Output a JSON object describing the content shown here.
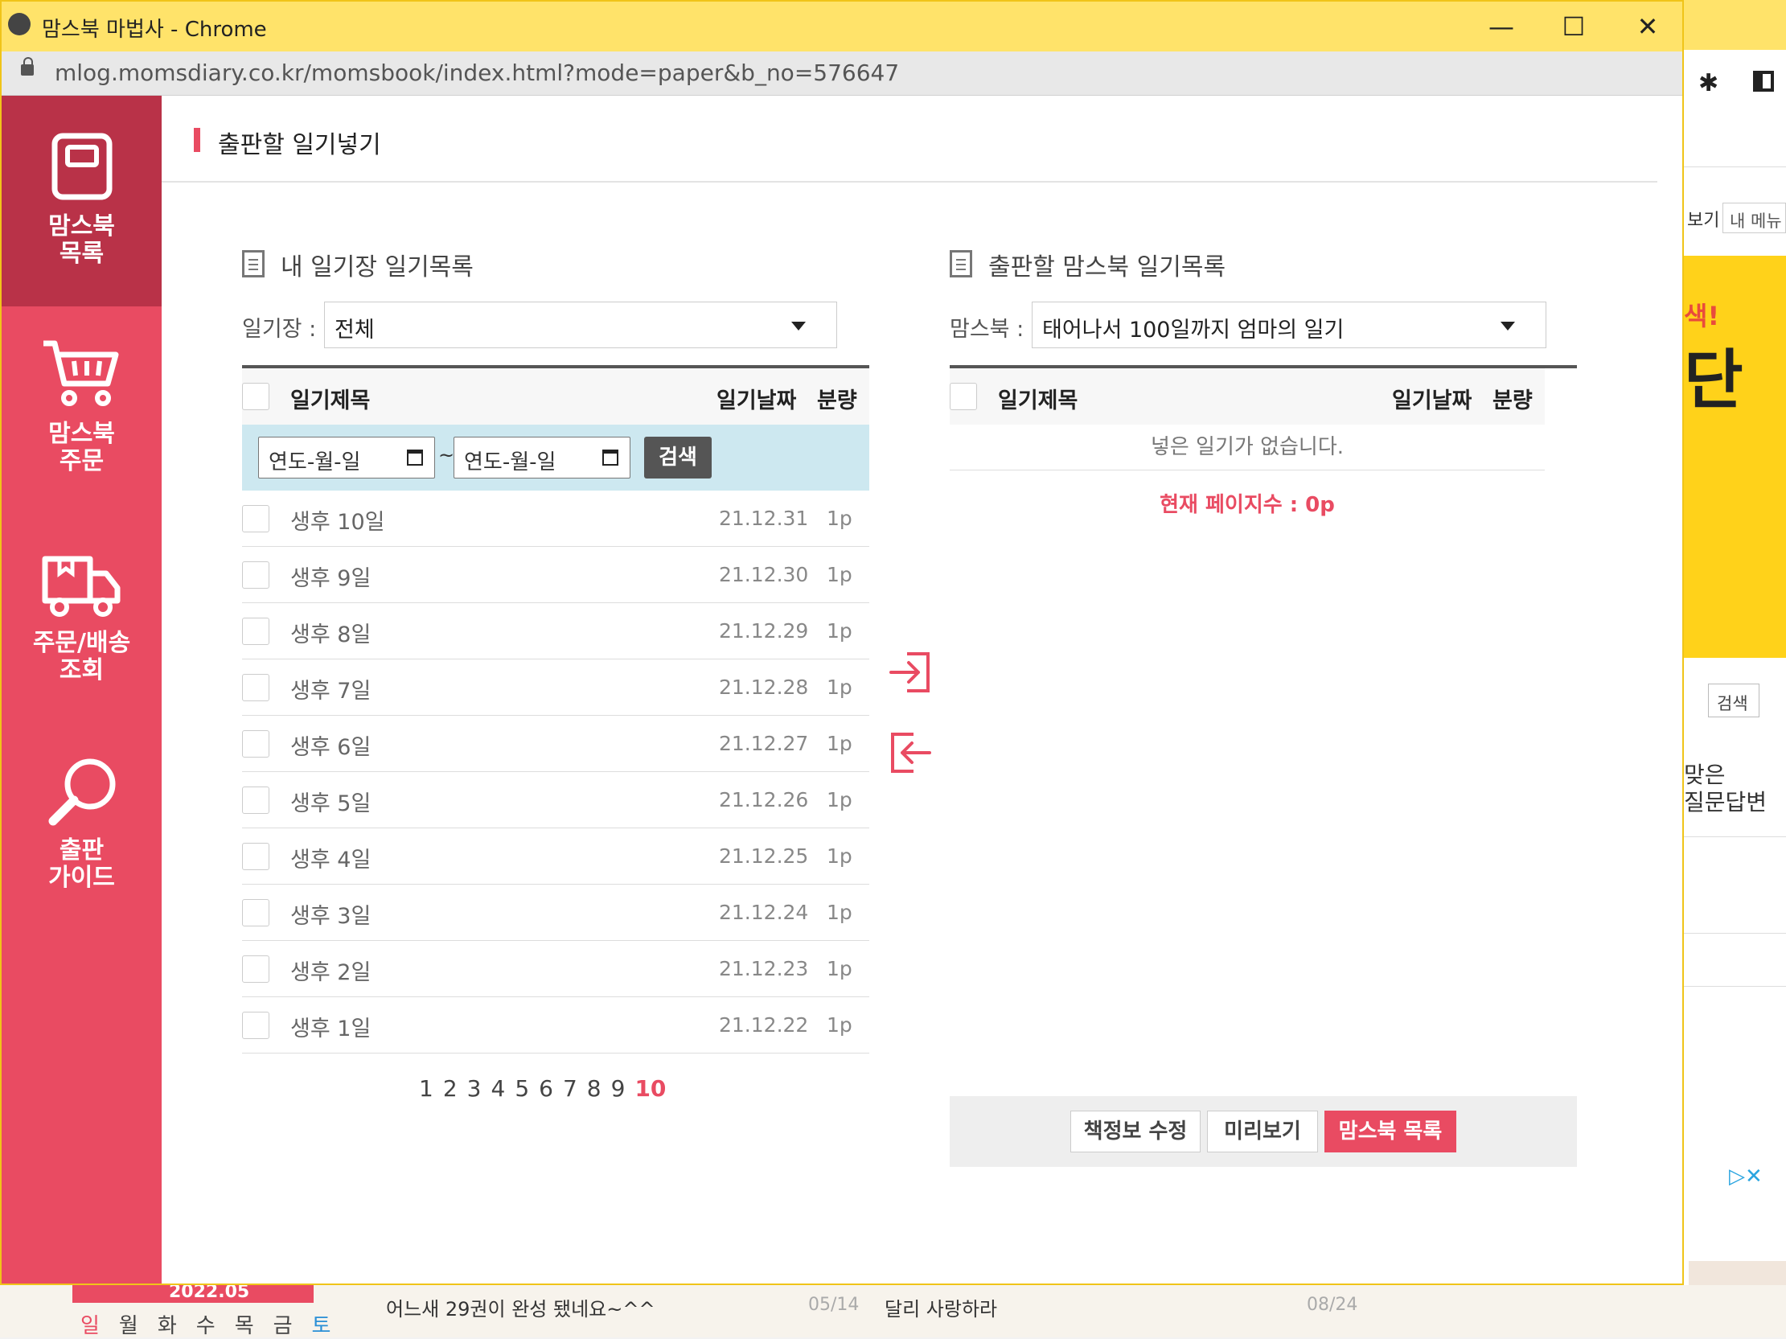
{
  "window": {
    "title": "맘스북 마법사 - Chrome",
    "url": "mlog.momsdiary.co.kr/momsbook/index.html?mode=paper&b_no=576647",
    "minimize_glyph": "—",
    "maximize_glyph": "☐",
    "close_glyph": "✕"
  },
  "sidebar": {
    "items": [
      {
        "label_1": "맘스북",
        "label_2": "목록",
        "icon": "book-icon",
        "active": true
      },
      {
        "label_1": "맘스북",
        "label_2": "주문",
        "icon": "cart-icon",
        "active": false
      },
      {
        "label_1": "주문/배송",
        "label_2": "조회",
        "icon": "truck-icon",
        "active": false
      },
      {
        "label_1": "출판",
        "label_2": "가이드",
        "icon": "magnifier-icon",
        "active": false
      }
    ]
  },
  "page": {
    "title": "출판할 일기넣기"
  },
  "left_panel": {
    "title": "내 일기장 일기목록",
    "select_label": "일기장 :",
    "select_value": "전체",
    "columns": {
      "title": "일기제목",
      "date": "일기날짜",
      "pages": "분량"
    },
    "date_from_placeholder": "연도-월-일",
    "date_to_placeholder": "연도-월-일",
    "date_separator": "~",
    "search_label": "검색",
    "rows": [
      {
        "title": "생후 10일",
        "date": "21.12.31",
        "pages": "1p"
      },
      {
        "title": "생후 9일",
        "date": "21.12.30",
        "pages": "1p"
      },
      {
        "title": "생후 8일",
        "date": "21.12.29",
        "pages": "1p"
      },
      {
        "title": "생후 7일",
        "date": "21.12.28",
        "pages": "1p"
      },
      {
        "title": "생후 6일",
        "date": "21.12.27",
        "pages": "1p"
      },
      {
        "title": "생후 5일",
        "date": "21.12.26",
        "pages": "1p"
      },
      {
        "title": "생후 4일",
        "date": "21.12.25",
        "pages": "1p"
      },
      {
        "title": "생후 3일",
        "date": "21.12.24",
        "pages": "1p"
      },
      {
        "title": "생후 2일",
        "date": "21.12.23",
        "pages": "1p"
      },
      {
        "title": "생후 1일",
        "date": "21.12.22",
        "pages": "1p"
      }
    ],
    "pagination": [
      "1",
      "2",
      "3",
      "4",
      "5",
      "6",
      "7",
      "8",
      "9",
      "10"
    ],
    "current_page": "10"
  },
  "right_panel": {
    "title": "출판할 맘스북 일기목록",
    "select_label": "맘스북 :",
    "select_value": "태어나서 100일까지 엄마의 일기",
    "columns": {
      "title": "일기제목",
      "date": "일기날짜",
      "pages": "분량"
    },
    "empty_message": "넣은 일기가 없습니다.",
    "page_count": "현재 페이지수 : 0p",
    "buttons": {
      "edit_info": "책정보 수정",
      "preview": "미리보기",
      "list": "맘스북 목록"
    }
  },
  "background_page": {
    "tab_label_1": "보기",
    "tab_label_2": "내 메뉴",
    "ad_text_1": "색!",
    "ad_text_2": "단",
    "search_label": "검색",
    "qa_line_1": "맞은",
    "qa_line_2": "질문답변",
    "calendar_title": "2022.05",
    "weekdays": [
      "일",
      "월",
      "화",
      "수",
      "목",
      "금",
      "토"
    ],
    "posts": [
      {
        "title": "어느새 29권이 완성 됐네요~^^",
        "date": "05/14"
      },
      {
        "title": "달리 사랑하라",
        "date": "08/24"
      }
    ]
  },
  "colors": {
    "accent": "#e94b62",
    "sidebar_active": "#b93248",
    "filter_bar": "#cde8f0",
    "chrome_titlebar": "#ffe36a"
  }
}
